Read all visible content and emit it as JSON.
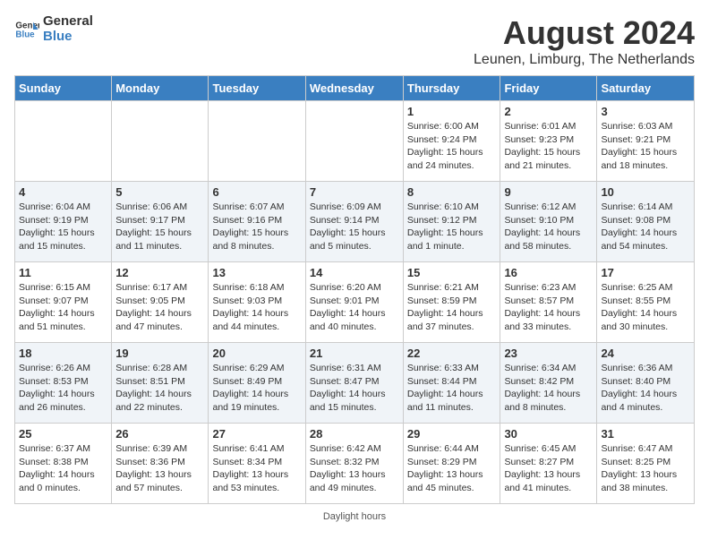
{
  "header": {
    "logo_line1": "General",
    "logo_line2": "Blue",
    "month_year": "August 2024",
    "location": "Leunen, Limburg, The Netherlands"
  },
  "weekdays": [
    "Sunday",
    "Monday",
    "Tuesday",
    "Wednesday",
    "Thursday",
    "Friday",
    "Saturday"
  ],
  "weeks": [
    [
      {
        "day": "",
        "info": ""
      },
      {
        "day": "",
        "info": ""
      },
      {
        "day": "",
        "info": ""
      },
      {
        "day": "",
        "info": ""
      },
      {
        "day": "1",
        "info": "Sunrise: 6:00 AM\nSunset: 9:24 PM\nDaylight: 15 hours and 24 minutes."
      },
      {
        "day": "2",
        "info": "Sunrise: 6:01 AM\nSunset: 9:23 PM\nDaylight: 15 hours and 21 minutes."
      },
      {
        "day": "3",
        "info": "Sunrise: 6:03 AM\nSunset: 9:21 PM\nDaylight: 15 hours and 18 minutes."
      }
    ],
    [
      {
        "day": "4",
        "info": "Sunrise: 6:04 AM\nSunset: 9:19 PM\nDaylight: 15 hours and 15 minutes."
      },
      {
        "day": "5",
        "info": "Sunrise: 6:06 AM\nSunset: 9:17 PM\nDaylight: 15 hours and 11 minutes."
      },
      {
        "day": "6",
        "info": "Sunrise: 6:07 AM\nSunset: 9:16 PM\nDaylight: 15 hours and 8 minutes."
      },
      {
        "day": "7",
        "info": "Sunrise: 6:09 AM\nSunset: 9:14 PM\nDaylight: 15 hours and 5 minutes."
      },
      {
        "day": "8",
        "info": "Sunrise: 6:10 AM\nSunset: 9:12 PM\nDaylight: 15 hours and 1 minute."
      },
      {
        "day": "9",
        "info": "Sunrise: 6:12 AM\nSunset: 9:10 PM\nDaylight: 14 hours and 58 minutes."
      },
      {
        "day": "10",
        "info": "Sunrise: 6:14 AM\nSunset: 9:08 PM\nDaylight: 14 hours and 54 minutes."
      }
    ],
    [
      {
        "day": "11",
        "info": "Sunrise: 6:15 AM\nSunset: 9:07 PM\nDaylight: 14 hours and 51 minutes."
      },
      {
        "day": "12",
        "info": "Sunrise: 6:17 AM\nSunset: 9:05 PM\nDaylight: 14 hours and 47 minutes."
      },
      {
        "day": "13",
        "info": "Sunrise: 6:18 AM\nSunset: 9:03 PM\nDaylight: 14 hours and 44 minutes."
      },
      {
        "day": "14",
        "info": "Sunrise: 6:20 AM\nSunset: 9:01 PM\nDaylight: 14 hours and 40 minutes."
      },
      {
        "day": "15",
        "info": "Sunrise: 6:21 AM\nSunset: 8:59 PM\nDaylight: 14 hours and 37 minutes."
      },
      {
        "day": "16",
        "info": "Sunrise: 6:23 AM\nSunset: 8:57 PM\nDaylight: 14 hours and 33 minutes."
      },
      {
        "day": "17",
        "info": "Sunrise: 6:25 AM\nSunset: 8:55 PM\nDaylight: 14 hours and 30 minutes."
      }
    ],
    [
      {
        "day": "18",
        "info": "Sunrise: 6:26 AM\nSunset: 8:53 PM\nDaylight: 14 hours and 26 minutes."
      },
      {
        "day": "19",
        "info": "Sunrise: 6:28 AM\nSunset: 8:51 PM\nDaylight: 14 hours and 22 minutes."
      },
      {
        "day": "20",
        "info": "Sunrise: 6:29 AM\nSunset: 8:49 PM\nDaylight: 14 hours and 19 minutes."
      },
      {
        "day": "21",
        "info": "Sunrise: 6:31 AM\nSunset: 8:47 PM\nDaylight: 14 hours and 15 minutes."
      },
      {
        "day": "22",
        "info": "Sunrise: 6:33 AM\nSunset: 8:44 PM\nDaylight: 14 hours and 11 minutes."
      },
      {
        "day": "23",
        "info": "Sunrise: 6:34 AM\nSunset: 8:42 PM\nDaylight: 14 hours and 8 minutes."
      },
      {
        "day": "24",
        "info": "Sunrise: 6:36 AM\nSunset: 8:40 PM\nDaylight: 14 hours and 4 minutes."
      }
    ],
    [
      {
        "day": "25",
        "info": "Sunrise: 6:37 AM\nSunset: 8:38 PM\nDaylight: 14 hours and 0 minutes."
      },
      {
        "day": "26",
        "info": "Sunrise: 6:39 AM\nSunset: 8:36 PM\nDaylight: 13 hours and 57 minutes."
      },
      {
        "day": "27",
        "info": "Sunrise: 6:41 AM\nSunset: 8:34 PM\nDaylight: 13 hours and 53 minutes."
      },
      {
        "day": "28",
        "info": "Sunrise: 6:42 AM\nSunset: 8:32 PM\nDaylight: 13 hours and 49 minutes."
      },
      {
        "day": "29",
        "info": "Sunrise: 6:44 AM\nSunset: 8:29 PM\nDaylight: 13 hours and 45 minutes."
      },
      {
        "day": "30",
        "info": "Sunrise: 6:45 AM\nSunset: 8:27 PM\nDaylight: 13 hours and 41 minutes."
      },
      {
        "day": "31",
        "info": "Sunrise: 6:47 AM\nSunset: 8:25 PM\nDaylight: 13 hours and 38 minutes."
      }
    ]
  ],
  "footer": {
    "daylight_label": "Daylight hours"
  }
}
